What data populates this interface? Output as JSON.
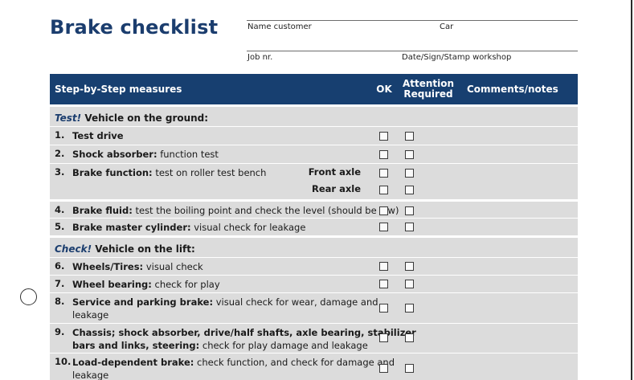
{
  "title": "Brake checklist",
  "fields": {
    "name_customer": "Name customer",
    "car": "Car",
    "job_nr": "Job nr.",
    "date_sign": "Date/Sign/Stamp workshop"
  },
  "header": {
    "measures": "Step-by-Step measures",
    "ok": "OK",
    "attention_line1": "Attention",
    "attention_line2": "Required",
    "comments": "Comments/notes"
  },
  "section1": {
    "emph": "Test!",
    "rest": " Vehicle on the ground:"
  },
  "section2": {
    "emph": "Check!",
    "rest": " Vehicle on the lift:"
  },
  "items": [
    {
      "num": "1.",
      "bold": "Test drive",
      "rest": ""
    },
    {
      "num": "2.",
      "bold": "Shock absorber:",
      "rest": " function test"
    },
    {
      "num": "3.",
      "bold": "Brake function:",
      "rest": " test on roller test bench",
      "sub1": "Front axle",
      "sub2": "Rear axle"
    },
    {
      "num": "4.",
      "bold": "Brake fluid:",
      "rest": " test the boiling point and check the level (should be low)"
    },
    {
      "num": "5.",
      "bold": "Brake master cylinder:",
      "rest": " visual check for leakage"
    },
    {
      "num": "6.",
      "bold": "Wheels/Tires:",
      "rest": " visual check"
    },
    {
      "num": "7.",
      "bold": "Wheel bearing:",
      "rest": " check for play"
    },
    {
      "num": "8.",
      "bold": "Service and parking brake:",
      "rest": " visual check for wear, damage and",
      "line2": "leakage"
    },
    {
      "num": "9.",
      "bold": "Chassis; shock absorber, drive/half shafts, axle bearing, stabilizer",
      "line2_bold": "bars and links, steering:",
      "line2_rest": " check for play damage and leakage"
    },
    {
      "num": "10.",
      "bold": "Load-dependent brake:",
      "rest": " check function, and check for damage and",
      "line2": "leakage"
    }
  ]
}
